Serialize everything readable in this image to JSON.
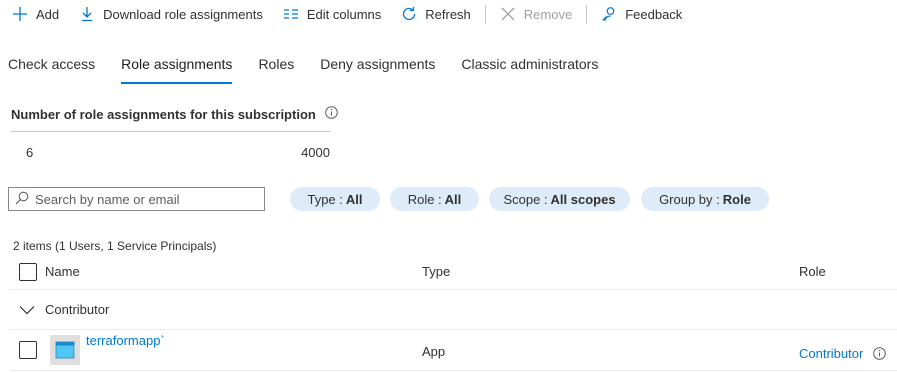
{
  "toolbar": {
    "add": "Add",
    "download": "Download role assignments",
    "edit_columns": "Edit columns",
    "refresh": "Refresh",
    "remove": "Remove",
    "feedback": "Feedback"
  },
  "tabs": [
    {
      "label": "Check access",
      "active": false
    },
    {
      "label": "Role assignments",
      "active": true
    },
    {
      "label": "Roles",
      "active": false
    },
    {
      "label": "Deny assignments",
      "active": false
    },
    {
      "label": "Classic administrators",
      "active": false
    }
  ],
  "summary": {
    "title": "Number of role assignments for this subscription",
    "current": "6",
    "max": "4000"
  },
  "search": {
    "placeholder": "Search by name or email",
    "value": ""
  },
  "filters": [
    {
      "label": "Type :",
      "value": "All"
    },
    {
      "label": "Role :",
      "value": "All"
    },
    {
      "label": "Scope :",
      "value": "All scopes"
    },
    {
      "label": "Group by :",
      "value": "Role"
    }
  ],
  "list": {
    "count_text": "2 items (1 Users, 1 Service Principals)",
    "columns": {
      "name": "Name",
      "type": "Type",
      "role": "Role"
    },
    "groups": [
      {
        "label": "Contributor",
        "rows": [
          {
            "name": "terraformapp`",
            "type": "App",
            "role": "Contributor"
          }
        ]
      }
    ]
  },
  "colors": {
    "accent": "#0078d4",
    "pill_bg": "#deecf9",
    "text": "#323130",
    "disabled": "#a19f9d"
  }
}
